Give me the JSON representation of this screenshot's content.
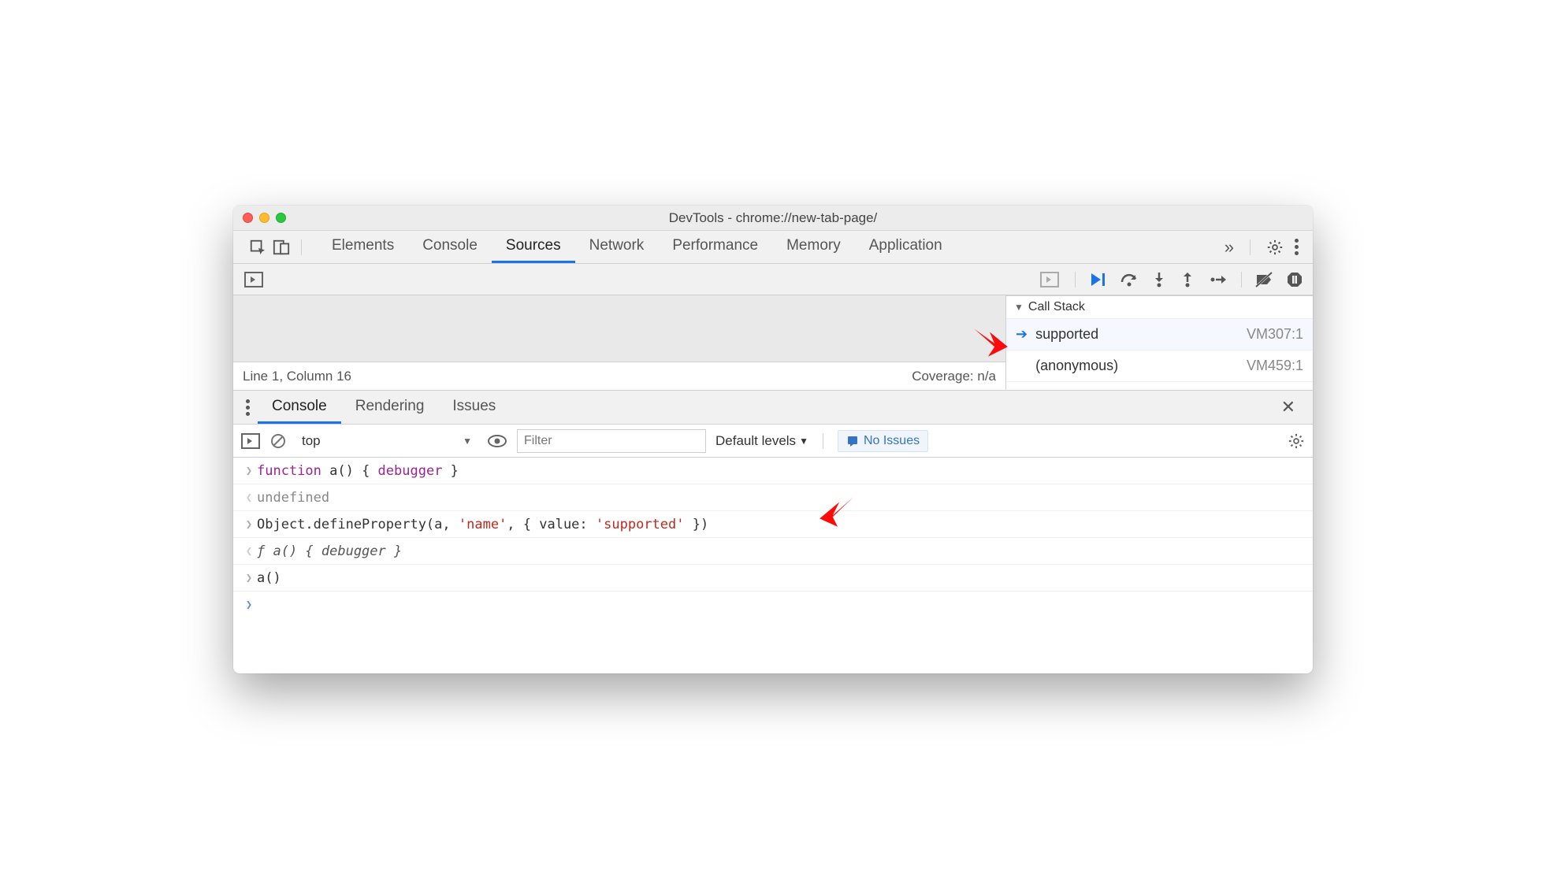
{
  "window": {
    "title": "DevTools - chrome://new-tab-page/"
  },
  "tabs": {
    "items": [
      "Elements",
      "Console",
      "Sources",
      "Network",
      "Performance",
      "Memory",
      "Application"
    ],
    "active": "Sources"
  },
  "sources": {
    "status": "Line 1, Column 16",
    "coverage": "Coverage: n/a"
  },
  "call_stack": {
    "label": "Call Stack",
    "frames": [
      {
        "name": "supported",
        "location": "VM307:1",
        "current": true
      },
      {
        "name": "(anonymous)",
        "location": "VM459:1",
        "current": false
      }
    ]
  },
  "drawer": {
    "tabs": [
      "Console",
      "Rendering",
      "Issues"
    ],
    "active": "Console"
  },
  "console_tb": {
    "context": "top",
    "filter_placeholder": "Filter",
    "levels": "Default levels",
    "issues": "No Issues"
  },
  "console": {
    "lines": [
      {
        "type": "in",
        "html": "<span class='kw-purple'>function</span> a() { <span class='kw-purple'>debugger</span> }"
      },
      {
        "type": "out",
        "html": "undefined"
      },
      {
        "type": "in",
        "html": "Object.defineProperty(a, <span class='kw-str'>'name'</span>, { value: <span class='kw-str'>'supported'</span> })"
      },
      {
        "type": "out",
        "html": "<span class='kw-ital'>ƒ a() { debugger }</span>"
      },
      {
        "type": "in",
        "html": "a()"
      }
    ]
  }
}
